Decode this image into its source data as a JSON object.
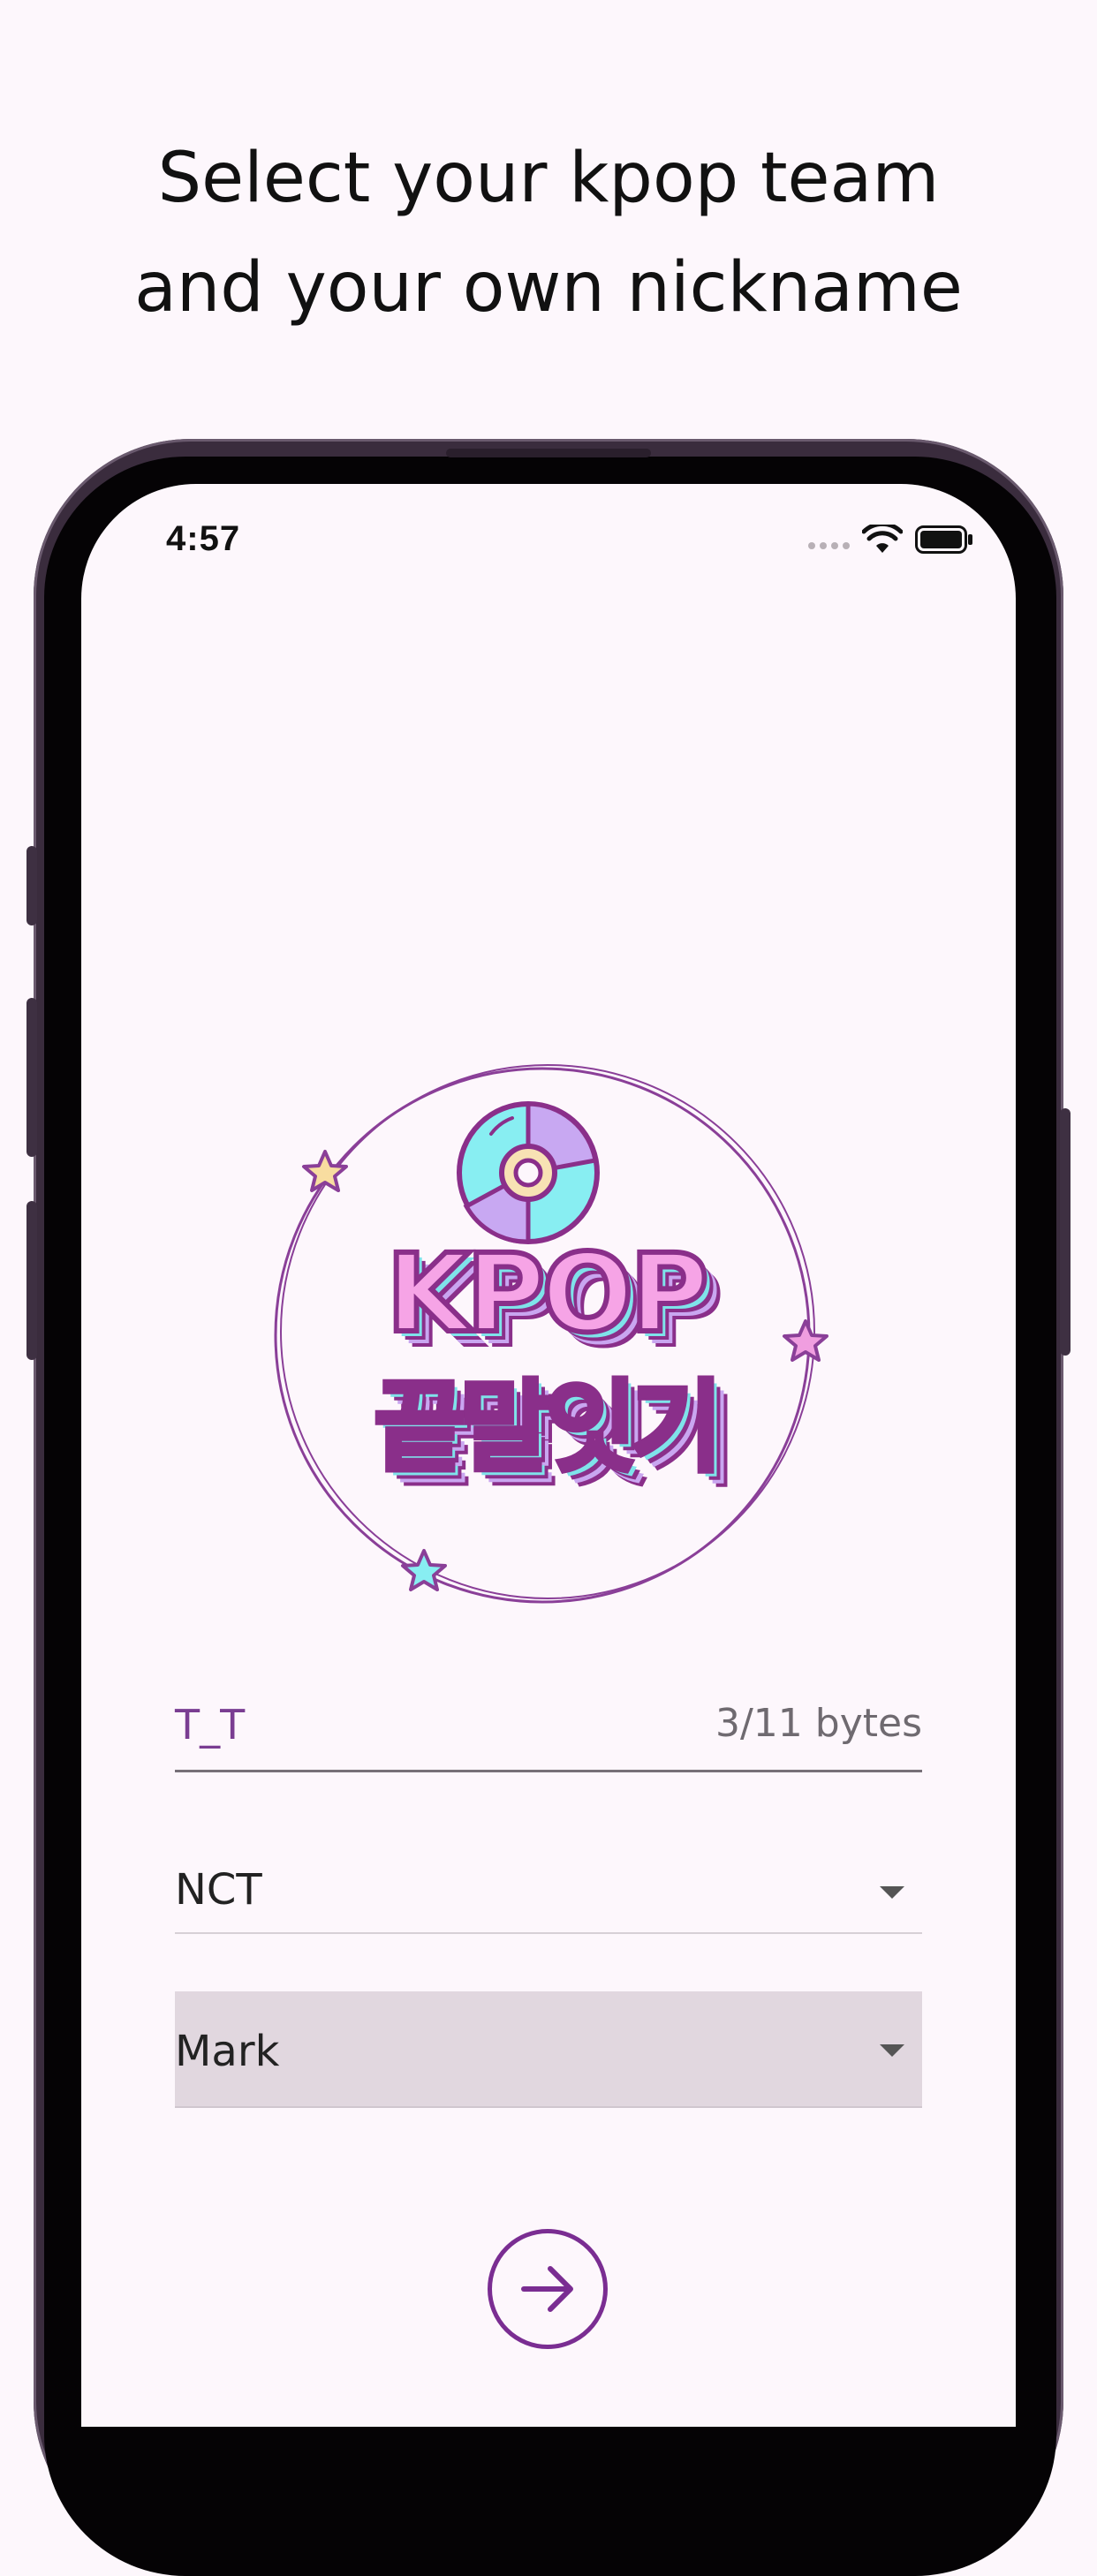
{
  "headline": {
    "line1": "Select your kpop team",
    "line2": "and your own nickname"
  },
  "status_bar": {
    "time": "4:57"
  },
  "logo": {
    "line1": "KPOP",
    "line2": "끝말잇기"
  },
  "nickname": {
    "value": "T_T",
    "byte_count": "3/11 bytes"
  },
  "team_select": {
    "selected": "NCT"
  },
  "member_select": {
    "selected": "Mark"
  },
  "colors": {
    "accent": "#7a2d92",
    "background": "#fdf7fc",
    "logo_pink": "#f6a4e6",
    "logo_cyan": "#7fe3ea"
  },
  "icons": {
    "next": "arrow-right-icon",
    "wifi": "wifi-icon",
    "battery": "battery-icon",
    "caret": "chevron-down-icon"
  }
}
